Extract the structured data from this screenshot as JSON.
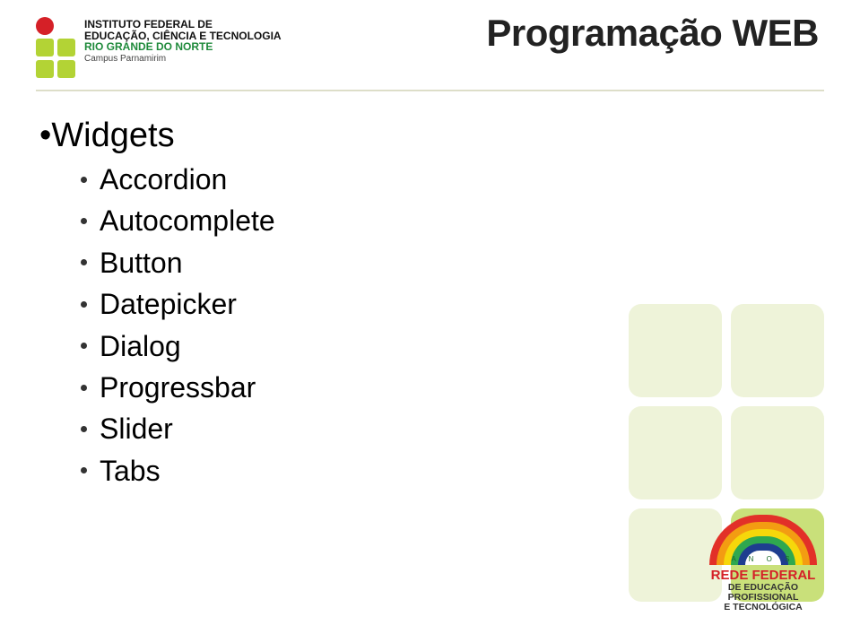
{
  "header": {
    "title": "Programação WEB",
    "institute": {
      "line1": "INSTITUTO FEDERAL DE",
      "line2": "EDUCAÇÃO, CIÊNCIA E TECNOLOGIA",
      "line3": "RIO GRANDE DO NORTE",
      "campus": "Campus Parnamirim"
    }
  },
  "content": {
    "heading": "Widgets",
    "items": [
      "Accordion",
      "Autocomplete",
      "Button",
      "Datepicker",
      "Dialog",
      "Progressbar",
      "Slider",
      "Tabs"
    ]
  },
  "badge": {
    "anos": "A  N  O  S",
    "line1": "REDE FEDERAL",
    "line2": "DE EDUCAÇÃO",
    "line3": "PROFISSIONAL",
    "line4": "E TECNOLÓGICA"
  }
}
